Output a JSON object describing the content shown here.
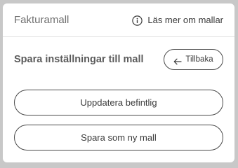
{
  "header": {
    "title": "Fakturamall",
    "info_link_label": "Läs mer om mallar",
    "info_icon": "info-circle-icon"
  },
  "section": {
    "title": "Spara inställningar till mall",
    "back_label": "Tillbaka",
    "back_icon": "arrow-left-icon"
  },
  "actions": {
    "update_existing_label": "Uppdatera befintlig",
    "save_new_label": "Spara som ny mall"
  }
}
